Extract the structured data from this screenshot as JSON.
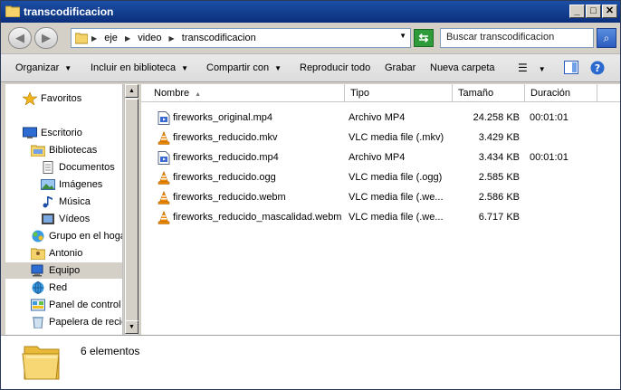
{
  "window": {
    "title": "transcodificacion",
    "min_label": "_",
    "max_label": "□",
    "close_label": "✕"
  },
  "address": {
    "crumbs": [
      "eje",
      "video",
      "transcodificacion"
    ],
    "search_placeholder": "Buscar transcodificacion"
  },
  "toolbar": {
    "organizar": "Organizar",
    "incluir": "Incluir en biblioteca",
    "compartir": "Compartir con",
    "reproducir": "Reproducir todo",
    "grabar": "Grabar",
    "nueva_carpeta": "Nueva carpeta"
  },
  "nav": {
    "items": [
      {
        "label": "Favoritos",
        "icon": "star-icon"
      },
      {
        "label": "Escritorio",
        "icon": "desktop-icon"
      },
      {
        "label": "Bibliotecas",
        "icon": "libraries-icon"
      },
      {
        "label": "Documentos",
        "icon": "documents-icon"
      },
      {
        "label": "Imágenes",
        "icon": "pictures-icon"
      },
      {
        "label": "Música",
        "icon": "music-icon"
      },
      {
        "label": "Vídeos",
        "icon": "videos-icon"
      },
      {
        "label": "Grupo en el hogar",
        "icon": "homegroup-icon"
      },
      {
        "label": "Antonio",
        "icon": "user-folder-icon"
      },
      {
        "label": "Equipo",
        "icon": "computer-icon"
      },
      {
        "label": "Red",
        "icon": "network-icon"
      },
      {
        "label": "Panel de control",
        "icon": "control-panel-icon"
      },
      {
        "label": "Papelera de reciclaje",
        "icon": "recycle-bin-icon"
      }
    ]
  },
  "columns": {
    "name": "Nombre",
    "type": "Tipo",
    "size": "Tamaño",
    "duration": "Duración"
  },
  "files": [
    {
      "name": "fireworks_original.mp4",
      "type": "Archivo MP4",
      "size": "24.258 KB",
      "duration": "00:01:01",
      "icon": "mp4-file-icon"
    },
    {
      "name": "fireworks_reducido.mkv",
      "type": "VLC media file (.mkv)",
      "size": "3.429 KB",
      "duration": "",
      "icon": "vlc-cone-icon"
    },
    {
      "name": "fireworks_reducido.mp4",
      "type": "Archivo MP4",
      "size": "3.434 KB",
      "duration": "00:01:01",
      "icon": "mp4-file-icon"
    },
    {
      "name": "fireworks_reducido.ogg",
      "type": "VLC media file (.ogg)",
      "size": "2.585 KB",
      "duration": "",
      "icon": "vlc-cone-icon"
    },
    {
      "name": "fireworks_reducido.webm",
      "type": "VLC media file (.we...",
      "size": "2.586 KB",
      "duration": "",
      "icon": "vlc-cone-icon"
    },
    {
      "name": "fireworks_reducido_mascalidad.webm",
      "type": "VLC media file (.we...",
      "size": "6.717 KB",
      "duration": "",
      "icon": "vlc-cone-icon"
    }
  ],
  "details": {
    "count": "6 elementos"
  },
  "colors": {
    "titlebar": "#0a2f7c",
    "selected_nav": "#d4d0c8",
    "vlc_orange": "#f08a00"
  }
}
